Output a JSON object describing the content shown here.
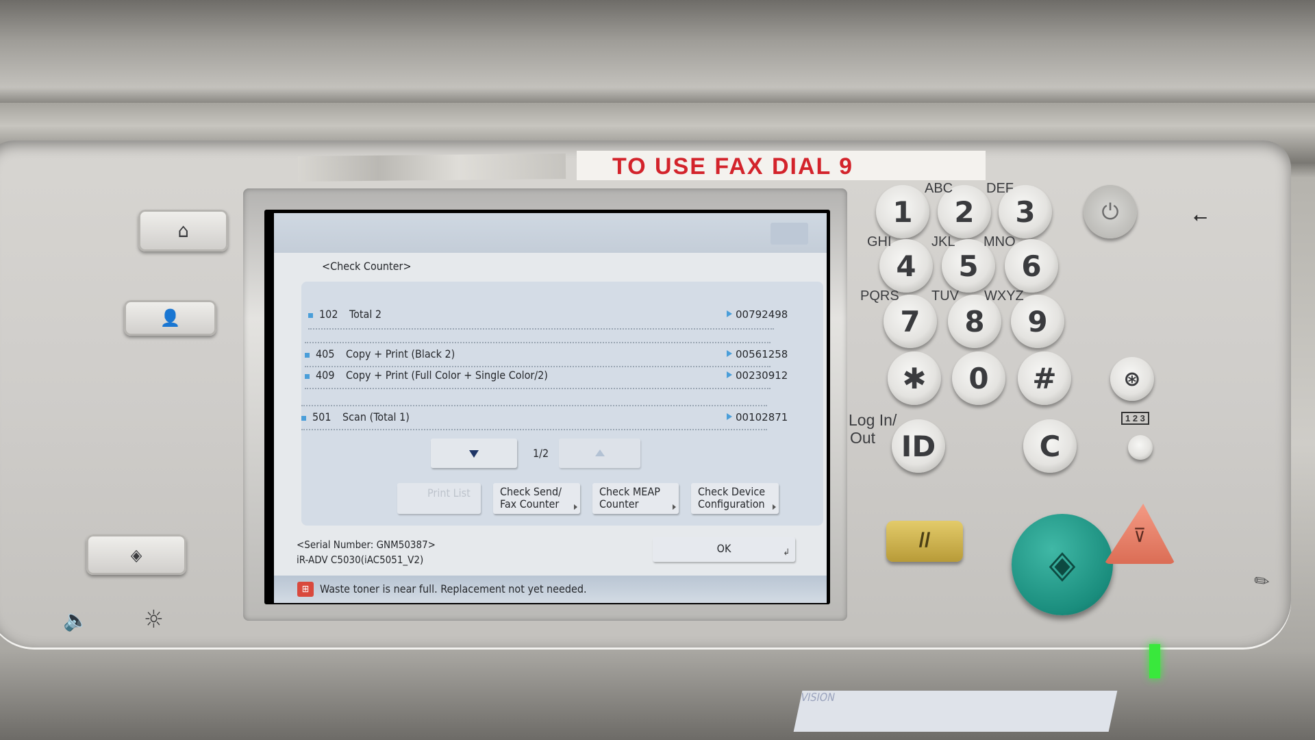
{
  "sticker": {
    "text": "TO USE FAX DIAL 9"
  },
  "screen": {
    "title": "<Check Counter>",
    "counters": [
      {
        "code": "102",
        "label": "Total 2",
        "value": "00792498"
      },
      {
        "code": "405",
        "label": "Copy + Print (Black 2)",
        "value": "00561258"
      },
      {
        "code": "409",
        "label": "Copy + Print (Full Color + Single Color/2)",
        "value": "00230912"
      },
      {
        "code": "501",
        "label": "Scan (Total 1)",
        "value": "00102871"
      }
    ],
    "page_indicator": "1/2",
    "buttons": {
      "print_list": "Print List",
      "check_send_fax": [
        "Check Send/",
        "Fax Counter"
      ],
      "check_meap": [
        "Check MEAP",
        "Counter"
      ],
      "check_device": [
        "Check Device",
        "Configuration"
      ],
      "ok": "OK"
    },
    "serial_number": "<Serial Number: GNM50387>",
    "model": "iR-ADV C5030(iAC5051_V2)",
    "status_message": "Waste toner is near full. Replacement not yet needed.",
    "accent_color": "#4a9ed9"
  },
  "keypad": {
    "keys": [
      "1",
      "2",
      "3",
      "4",
      "5",
      "6",
      "7",
      "8",
      "9",
      "✱",
      "0",
      "#"
    ],
    "letters": [
      "ABC",
      "DEF",
      "GHI",
      "JKL",
      "MNO",
      "PQRS",
      "TUV",
      "WXYZ"
    ],
    "login_label": [
      "Log In/",
      "Out"
    ],
    "id_key": "ID",
    "clear_key": "C",
    "counter_label": "1 2 3"
  },
  "indicators": {
    "power_led_color": "#39e83c"
  },
  "brand_sticker": "VISION"
}
